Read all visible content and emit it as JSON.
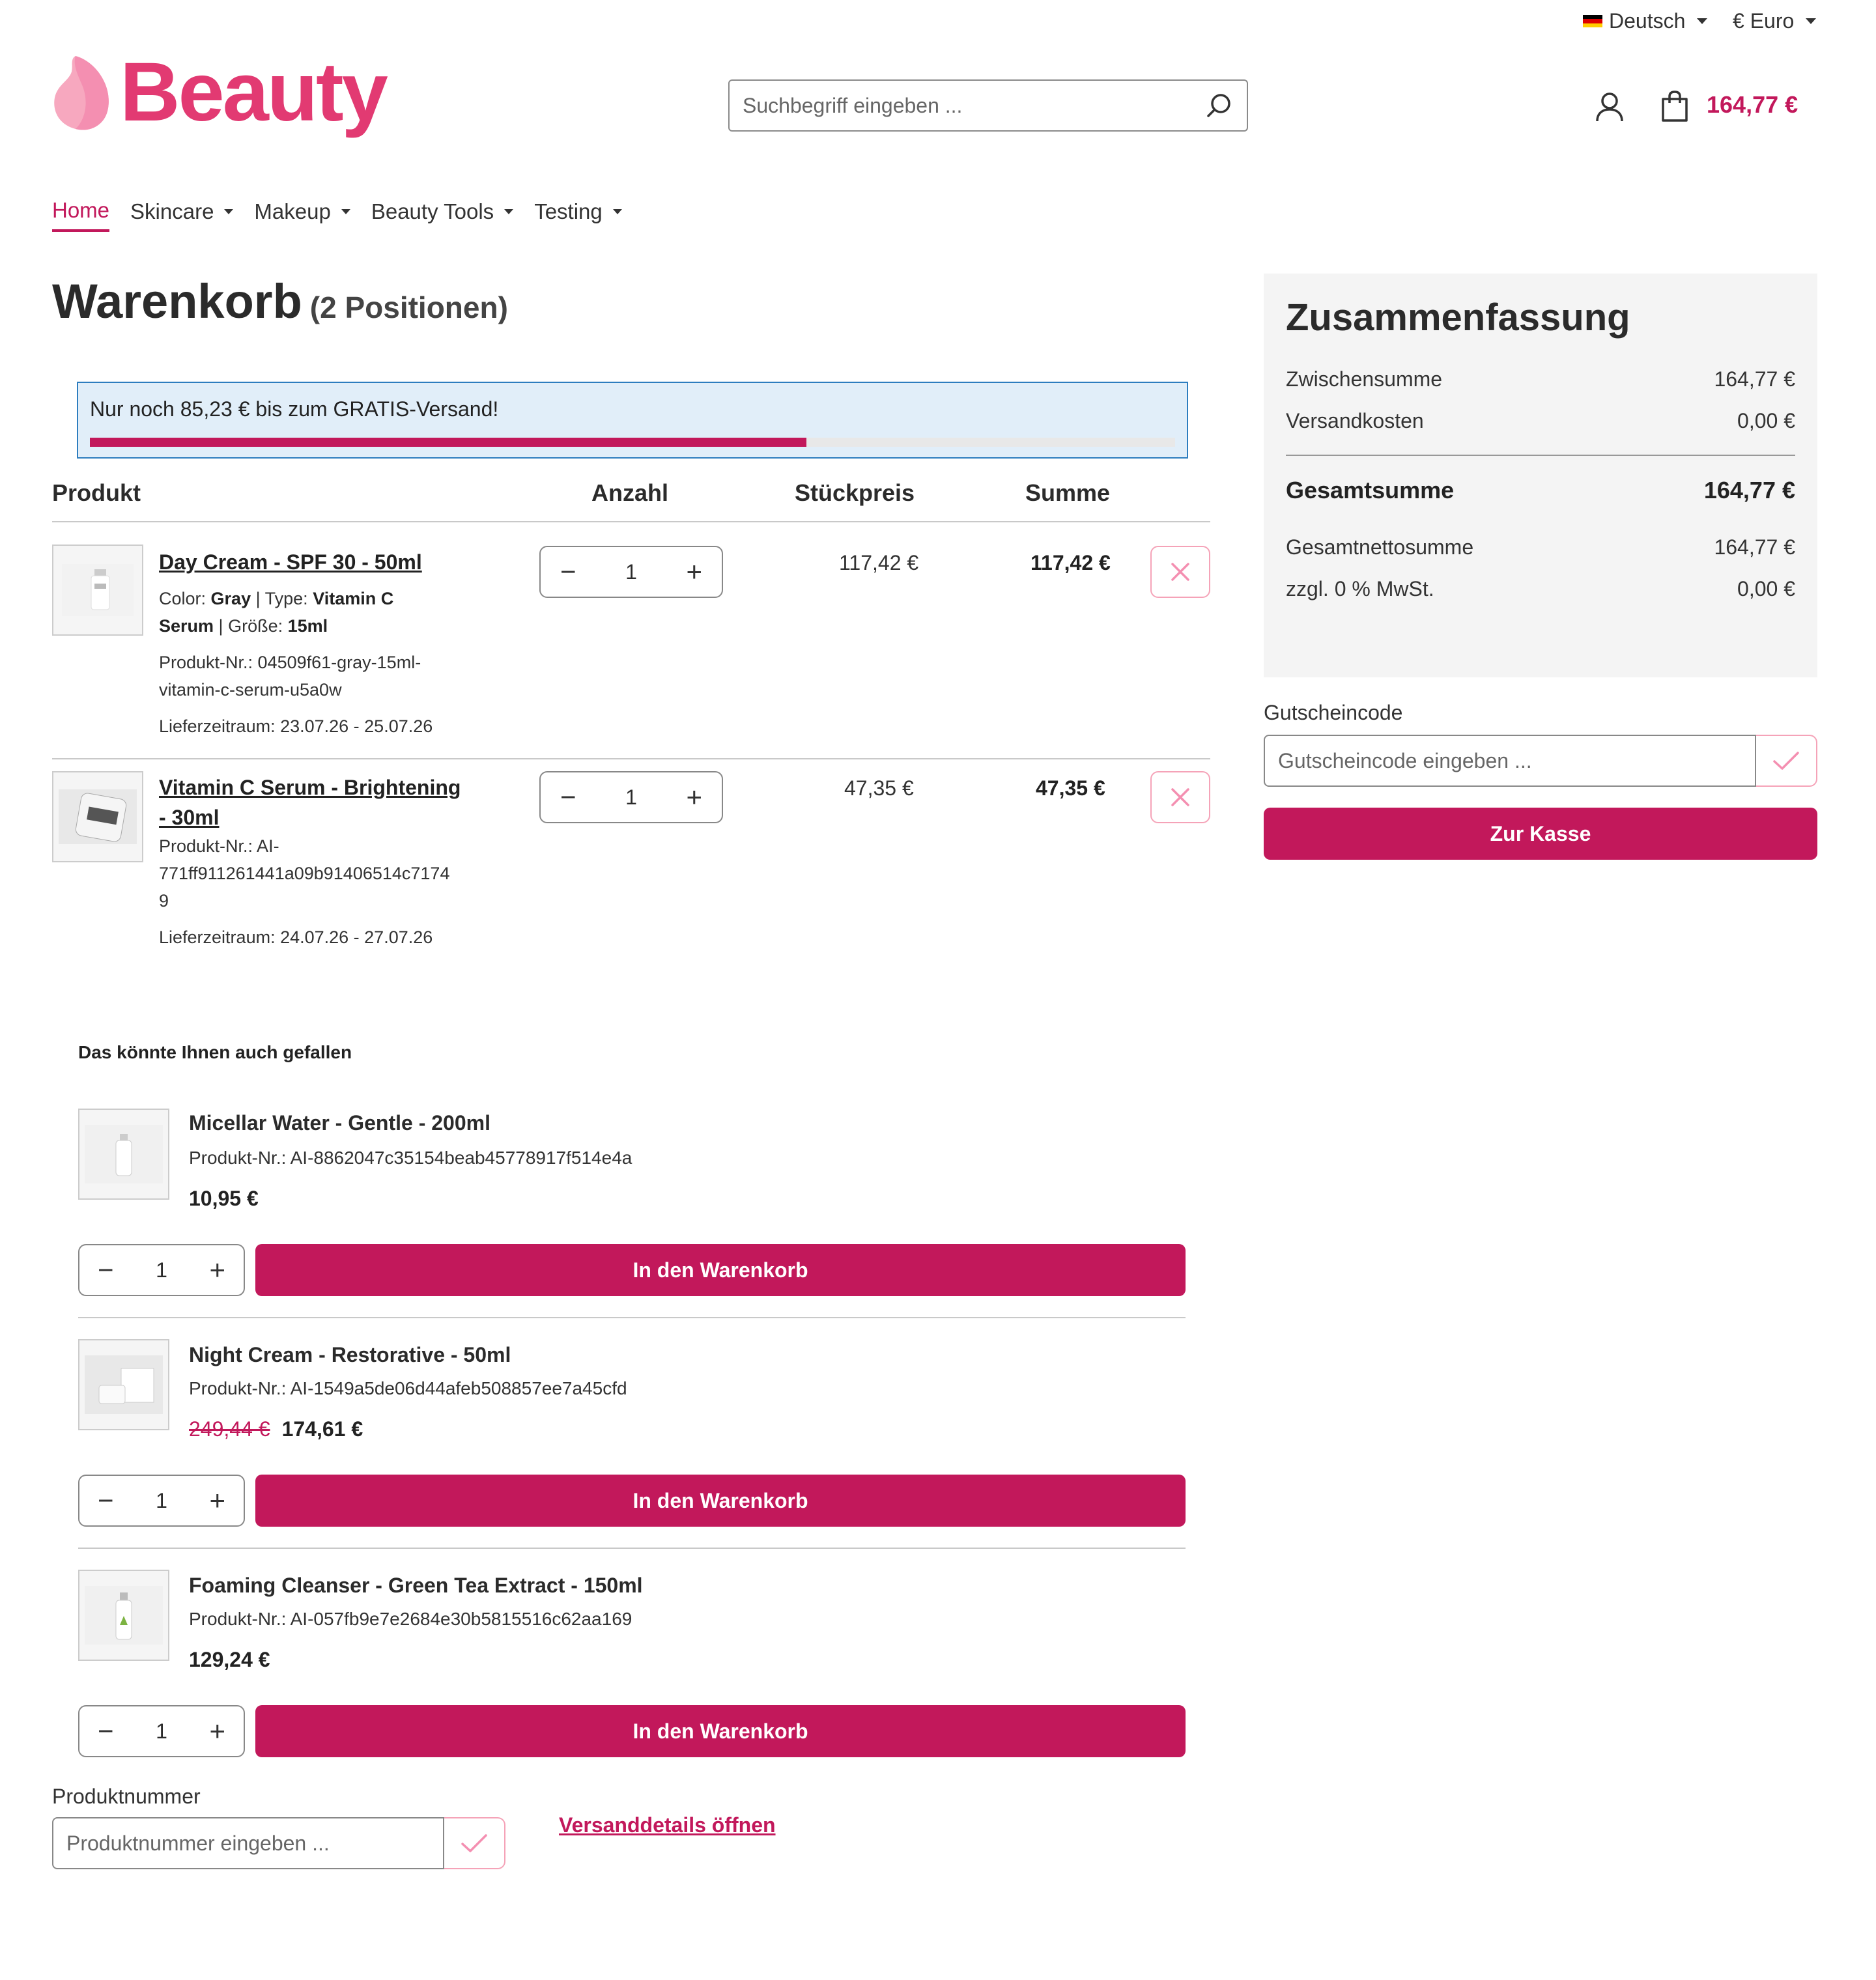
{
  "topbar": {
    "language": "Deutsch",
    "currency": "€ Euro"
  },
  "brand": {
    "name": "Beauty",
    "color": "#e23a72",
    "accent": "#c2185b"
  },
  "search": {
    "placeholder": "Suchbegriff eingeben ..."
  },
  "header": {
    "cart_total": "164,77 €"
  },
  "nav": {
    "items": [
      {
        "label": "Home",
        "active": true
      },
      {
        "label": "Skincare"
      },
      {
        "label": "Makeup"
      },
      {
        "label": "Beauty Tools"
      },
      {
        "label": "Testing"
      }
    ]
  },
  "cart": {
    "title": "Warenkorb",
    "count_label": "(2 Positionen)",
    "shipping_notice": "Nur noch 85,23 € bis zum GRATIS-Versand!",
    "shipping_progress": 0.66,
    "columns": [
      "Produkt",
      "Anzahl",
      "Stückpreis",
      "Summe"
    ],
    "items": [
      {
        "name": "Day Cream - SPF 30 - 50ml",
        "color_label": "Color:",
        "color_value": "Gray",
        "type_label": "Type:",
        "type_value_1": "Vitamin C",
        "type_value_2": "Serum",
        "size_label": "Größe:",
        "size_value": "15ml",
        "sku_line_1": "Produkt-Nr.: 04509f61-gray-15ml-",
        "sku_line_2": "vitamin-c-serum-u5a0w",
        "delivery": "Lieferzeitraum: 23.07.26 - 25.07.26",
        "qty": "1",
        "unit_price": "117,42 €",
        "total": "117,42 €"
      },
      {
        "name_line_1": "Vitamin C Serum - Brightening",
        "name_line_2": "- 30ml",
        "sku_line_1": "Produkt-Nr.: AI-",
        "sku_line_2": "771ff911261441a09b91406514c7174",
        "sku_line_3": "9",
        "delivery": "Lieferzeitraum: 24.07.26 - 27.07.26",
        "qty": "1",
        "unit_price": "47,35 €",
        "total": "47,35 €"
      }
    ]
  },
  "summary": {
    "title": "Zusammenfassung",
    "subtotal_label": "Zwischensumme",
    "subtotal": "164,77 €",
    "shipping_label": "Versandkosten",
    "shipping": "0,00 €",
    "total_label": "Gesamtsumme",
    "total": "164,77 €",
    "net_label": "Gesamtnettosumme",
    "net": "164,77 €",
    "tax_label": "zzgl. 0 % MwSt.",
    "tax": "0,00 €"
  },
  "voucher": {
    "label": "Gutscheincode",
    "placeholder": "Gutscheincode eingeben ...",
    "checkout_label": "Zur Kasse"
  },
  "recommendations": {
    "title": "Das könnte Ihnen auch gefallen",
    "add_label": "In den Warenkorb",
    "items": [
      {
        "name": "Micellar Water - Gentle - 200ml",
        "sku": "Produkt-Nr.: AI-8862047c35154beab45778917f514e4a",
        "price": "10,95 €",
        "qty": "1"
      },
      {
        "name": "Night Cream - Restorative - 50ml",
        "sku": "Produkt-Nr.: AI-1549a5de06d44afeb508857ee7a45cfd",
        "old_price": "249,44 €",
        "price": "174,61 €",
        "qty": "1"
      },
      {
        "name": "Foaming Cleanser - Green Tea Extract - 150ml",
        "sku": "Produkt-Nr.: AI-057fb9e7e2684e30b5815516c62aa169",
        "price": "129,24 €",
        "qty": "1"
      }
    ]
  },
  "product_number": {
    "label": "Produktnummer",
    "placeholder": "Produktnummer eingeben ..."
  },
  "shipping_details_link": "Versanddetails öffnen",
  "icons": {
    "search": "search-icon",
    "user": "user-icon",
    "cart": "cart-bag-icon",
    "remove": "close-icon",
    "check": "check-icon"
  }
}
